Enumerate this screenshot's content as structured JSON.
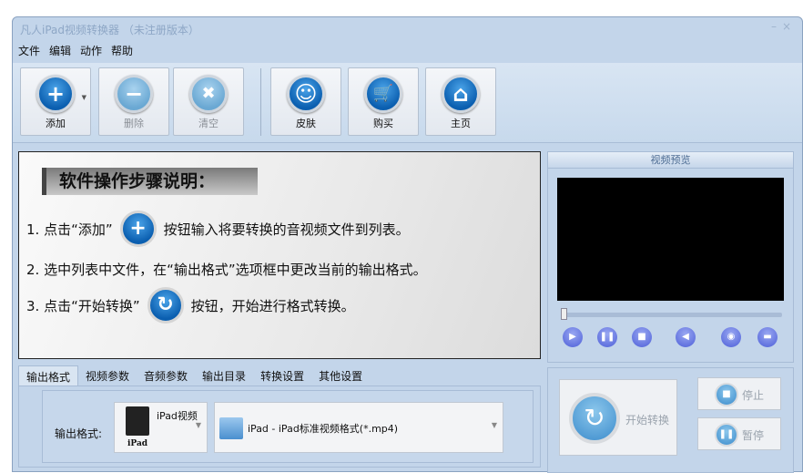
{
  "window": {
    "title": "凡人iPad视频转换器 （未注册版本）",
    "minimize": "–",
    "close": "×"
  },
  "menu": [
    "文件",
    "编辑",
    "动作",
    "帮助"
  ],
  "toolbar": [
    {
      "label": "添加",
      "icon": "plus-icon",
      "glyph": "+",
      "enabled": true
    },
    {
      "label": "删除",
      "icon": "minus-icon",
      "glyph": "−",
      "enabled": false
    },
    {
      "label": "清空",
      "icon": "clear-icon",
      "glyph": "✖",
      "enabled": false
    },
    {
      "label": "皮肤",
      "icon": "smiley-icon",
      "glyph": "☺",
      "enabled": true
    },
    {
      "label": "购买",
      "icon": "cart-icon",
      "glyph": "🛒",
      "enabled": true
    },
    {
      "label": "主页",
      "icon": "home-icon",
      "glyph": "⌂",
      "enabled": true
    }
  ],
  "guide": {
    "heading": "软件操作步骤说明：",
    "step1_a": "1. 点击“添加”",
    "step1_b": "按钮输入将要转换的音视频文件到列表。",
    "step2": "2. 选中列表中文件，在“输出格式”选项框中更改当前的输出格式。",
    "step3_a": "3. 点击“开始转换”",
    "step3_b": "按钮，开始进行格式转换。"
  },
  "preview": {
    "title": "视频预览",
    "progress": 0
  },
  "tabs": [
    "输出格式",
    "视频参数",
    "音频参数",
    "输出目录",
    "转换设置",
    "其他设置"
  ],
  "format": {
    "label": "输出格式:",
    "device": "iPad视频",
    "device_caption": "iPad",
    "profile": "iPad - iPad标准视频格式(*.mp4)"
  },
  "convert": {
    "start": "开始转换",
    "stop": "停止",
    "pause": "暂停"
  }
}
